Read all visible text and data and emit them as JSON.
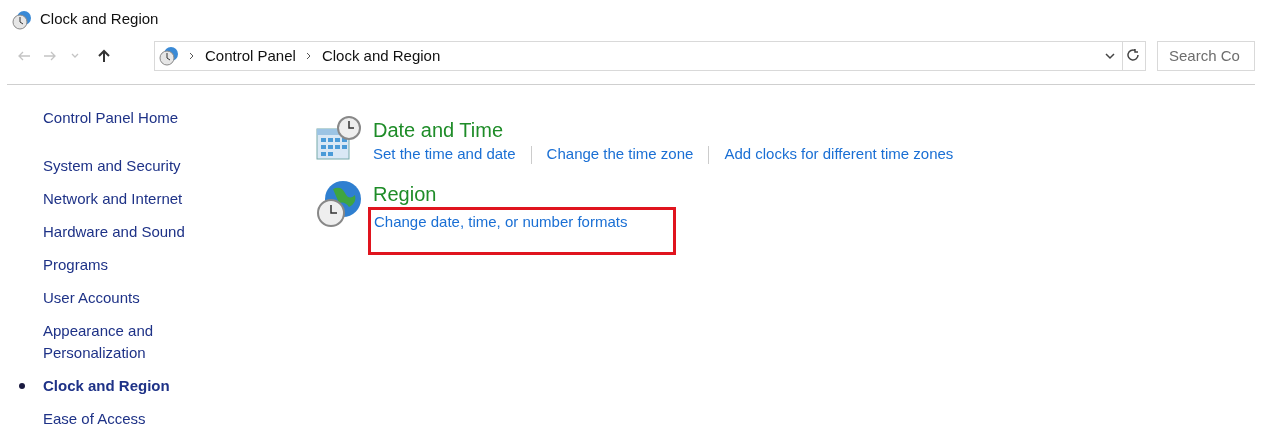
{
  "window": {
    "title": "Clock and Region"
  },
  "navigation": {
    "back": {
      "disabled": true
    },
    "forward": {
      "disabled": true
    },
    "recent": {
      "disabled": true
    },
    "up": {
      "disabled": false
    }
  },
  "address_bar": {
    "breadcrumbs": [
      "Control Panel",
      "Clock and Region"
    ]
  },
  "search": {
    "placeholder": "Search Co"
  },
  "sidebar": {
    "items": [
      {
        "label": "Control Panel Home",
        "selected": false,
        "kind": "home"
      },
      {
        "label": "System and Security",
        "selected": false,
        "kind": "category"
      },
      {
        "label": "Network and Internet",
        "selected": false,
        "kind": "category"
      },
      {
        "label": "Hardware and Sound",
        "selected": false,
        "kind": "category"
      },
      {
        "label": "Programs",
        "selected": false,
        "kind": "category"
      },
      {
        "label": "User Accounts",
        "selected": false,
        "kind": "category"
      },
      {
        "label": "Appearance and Personalization",
        "selected": false,
        "kind": "category"
      },
      {
        "label": "Clock and Region",
        "selected": true,
        "kind": "category"
      },
      {
        "label": "Ease of Access",
        "selected": false,
        "kind": "category"
      }
    ]
  },
  "sections": [
    {
      "kind": "datetime",
      "title": "Date and Time",
      "links": [
        {
          "label": "Set the time and date",
          "highlighted": false
        },
        {
          "label": "Change the time zone",
          "highlighted": false
        },
        {
          "label": "Add clocks for different time zones",
          "highlighted": false
        }
      ]
    },
    {
      "kind": "region",
      "title": "Region",
      "links": [
        {
          "label": "Change date, time, or number formats",
          "highlighted": true
        }
      ]
    }
  ]
}
